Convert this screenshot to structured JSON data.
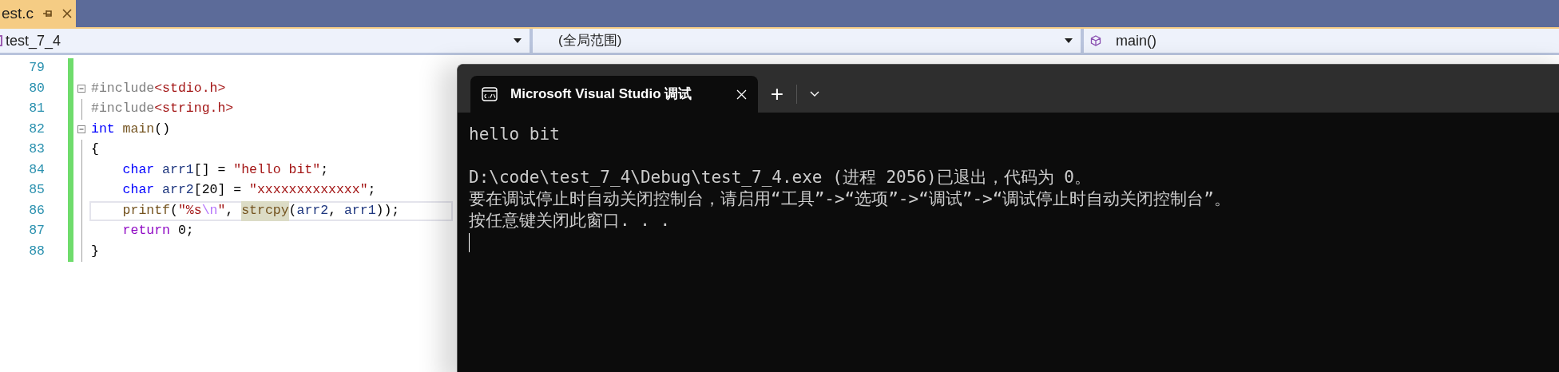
{
  "document_tab": {
    "title": "est.c",
    "selected": true
  },
  "nav_bar": {
    "project": "test_7_4",
    "scope": "(全局范围)",
    "member": "main()"
  },
  "editor": {
    "lines": [
      {
        "number": "79",
        "foldable": false
      },
      {
        "number": "80",
        "foldable": true,
        "current": false,
        "tokens": [
          {
            "text": "#include",
            "kind": "preproc"
          },
          {
            "text": "<stdio.h>",
            "kind": "string"
          }
        ]
      },
      {
        "number": "81",
        "foldable": false,
        "current": false,
        "tokens": [
          {
            "text": "#include",
            "kind": "preproc"
          },
          {
            "text": "<string.h>",
            "kind": "string"
          }
        ]
      },
      {
        "number": "82",
        "foldable": true,
        "current": false,
        "tokens": [
          {
            "text": "int",
            "kind": "keyword"
          },
          {
            "text": " main",
            "kind": "func"
          },
          {
            "text": "()",
            "kind": "plain"
          }
        ]
      },
      {
        "number": "83",
        "foldable": false,
        "current": false,
        "tokens": [
          {
            "text": "{",
            "kind": "plain"
          }
        ]
      },
      {
        "number": "84",
        "foldable": false,
        "current": false,
        "tokens": [
          {
            "text": "    char",
            "kind": "keyword"
          },
          {
            "text": " arr1",
            "kind": "ident"
          },
          {
            "text": "[] = ",
            "kind": "plain"
          },
          {
            "text": "\"hello bit\"",
            "kind": "string"
          },
          {
            "text": ";",
            "kind": "plain"
          }
        ]
      },
      {
        "number": "85",
        "foldable": false,
        "current": false,
        "tokens": [
          {
            "text": "    char",
            "kind": "keyword"
          },
          {
            "text": " arr2",
            "kind": "ident"
          },
          {
            "text": "[20] = ",
            "kind": "plain"
          },
          {
            "text": "\"xxxxxxxxxxxxx\"",
            "kind": "string"
          },
          {
            "text": ";",
            "kind": "plain"
          }
        ]
      },
      {
        "number": "86",
        "foldable": false,
        "current": true,
        "tokens": [
          {
            "text": "    printf",
            "kind": "func"
          },
          {
            "text": "(",
            "kind": "plain"
          },
          {
            "text": "\"%s",
            "kind": "string"
          },
          {
            "text": "\\n",
            "kind": "escape"
          },
          {
            "text": "\"",
            "kind": "string"
          },
          {
            "text": ", ",
            "kind": "plain"
          },
          {
            "text": "strcpy",
            "kind": "reference"
          },
          {
            "text": "(",
            "kind": "plain"
          },
          {
            "text": "arr2",
            "kind": "ident"
          },
          {
            "text": ", ",
            "kind": "plain"
          },
          {
            "text": "arr1",
            "kind": "ident"
          },
          {
            "text": "));",
            "kind": "plain"
          }
        ]
      },
      {
        "number": "87",
        "foldable": false,
        "current": false,
        "tokens": [
          {
            "text": "    return",
            "kind": "control"
          },
          {
            "text": " 0;",
            "kind": "plain"
          }
        ]
      },
      {
        "number": "88",
        "foldable": false,
        "current": false,
        "tokens": [
          {
            "text": "}",
            "kind": "plain"
          }
        ]
      }
    ]
  },
  "console": {
    "tab_title": "Microsoft Visual Studio 调试",
    "new_tab": "+",
    "output": "hello bit",
    "lines": [
      "D:\\code\\test_7_4\\Debug\\test_7_4.exe (进程 2056)已退出，代码为 0。",
      "要在调试停止时自动关闭控制台，请启用“工具”->“选项”->“调试”->“调试停止时自动关闭控制台”。",
      "按任意键关闭此窗口. . ."
    ]
  }
}
